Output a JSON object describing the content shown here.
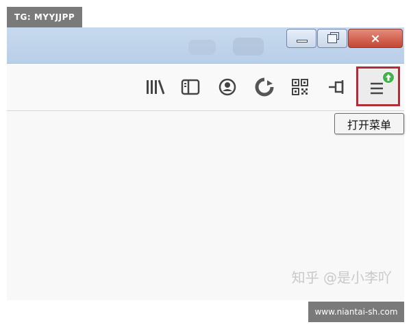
{
  "overlay": {
    "tag": "TG: MYYJJPP",
    "site": "www.niantai-sh.com"
  },
  "window": {
    "controls": {
      "minimize": "minimize-icon",
      "maximize": "maximize-icon",
      "close_symbol": "×"
    }
  },
  "toolbar": {
    "icons": [
      "library-icon",
      "sidebar-icon",
      "account-icon",
      "sync-icon",
      "qr-code-icon",
      "pin-icon",
      "menu-icon"
    ],
    "menu_badge": "update-badge-icon"
  },
  "tooltip": {
    "text": "打开菜单"
  },
  "content": {
    "watermark": "知乎 @是小李吖"
  },
  "colors": {
    "highlight": "#b22b36",
    "badge": "#42b34a",
    "titlebar": "#c7d9ee",
    "close_button": "#c44532"
  }
}
